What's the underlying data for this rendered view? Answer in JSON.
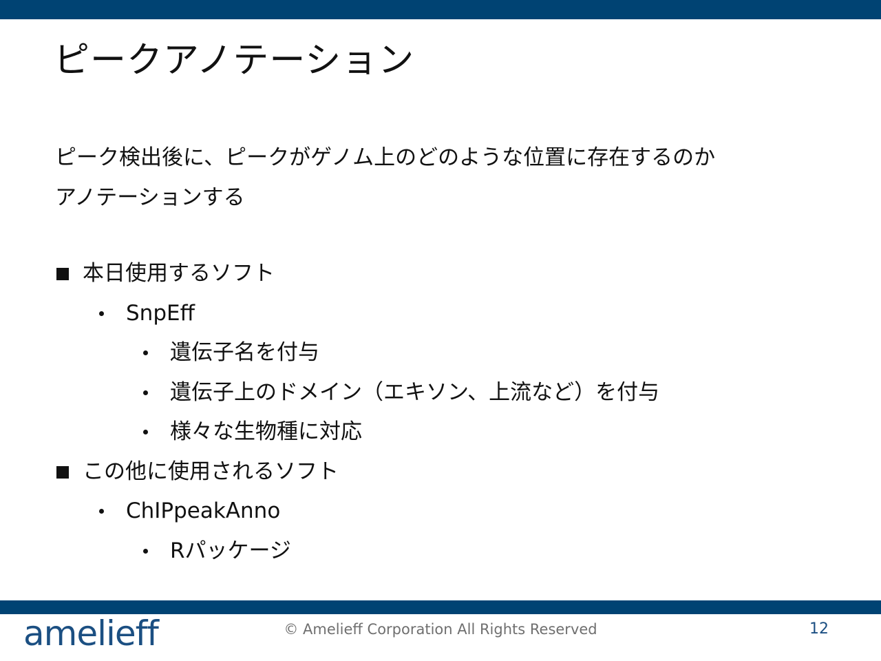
{
  "slide": {
    "title": "ピークアノテーション",
    "intro_line1": "ピーク検出後に、ピークがゲノム上のどのような位置に存在するのか",
    "intro_line2": "アノテーションする"
  },
  "bullets": [
    {
      "label": "本日使用するソフト",
      "items": [
        {
          "label": "SnpEff",
          "items": [
            "遺伝子名を付与",
            "遺伝子上のドメイン（エキソン、上流など）を付与",
            "様々な生物種に対応"
          ]
        }
      ]
    },
    {
      "label": "この他に使用されるソフト",
      "items": [
        {
          "label": "ChIPpeakAnno",
          "items": [
            "Rパッケージ"
          ]
        }
      ]
    }
  ],
  "footer": {
    "logo_text": "amelieff",
    "copyright": "© Amelieff Corporation All Rights Reserved",
    "page_number": "12"
  },
  "colors": {
    "bar": "#004373",
    "logo": "#1b4f82",
    "copyright_text": "#6f6f6f"
  }
}
